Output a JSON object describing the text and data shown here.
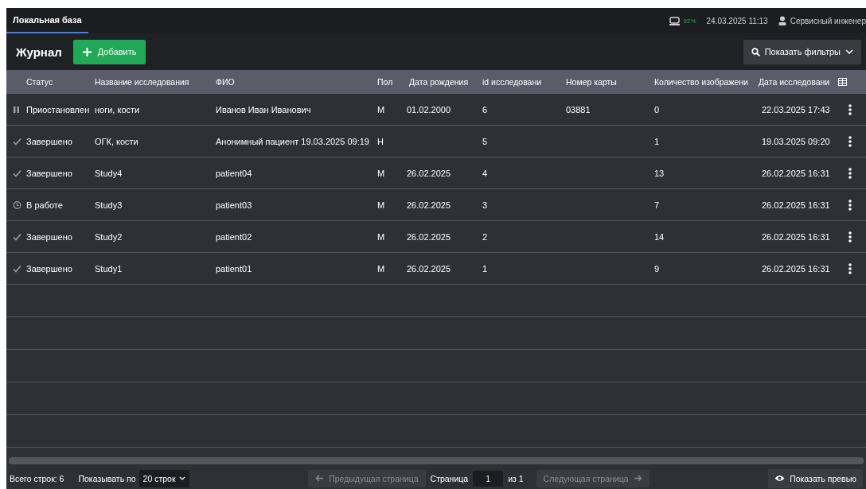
{
  "top_bar": {
    "tabs": [
      {
        "label": "Локальная база",
        "selected": true
      }
    ],
    "storage": "92%",
    "datetime": "24.03.2025 11:13",
    "user": "Сервисный инженер"
  },
  "toolbar": {
    "title": "Журнал",
    "add_button": "Добавить",
    "filters_button": "Показать фильтры"
  },
  "table": {
    "columns": [
      "Статус",
      "Название исследования",
      "ФИО",
      "Пол",
      "Дата рождения",
      "id исследовани",
      "Номер карты",
      "Количество изображени",
      "Дата исследовани"
    ],
    "rows": [
      {
        "kind": "paused",
        "status": "Приостановлен",
        "name": "ноги, кости",
        "patient": "Иванов Иван Иванович",
        "sex": "М",
        "birth_date": "01.02.2000",
        "study_id": "6",
        "card": "03881",
        "images": "0",
        "study_date": "22.03.2025 17:43"
      },
      {
        "kind": "done",
        "status": "Завершено",
        "name": "ОГК, кости",
        "patient": "Анонимный пациент 19.03.2025 09:19",
        "sex": "Н",
        "study_id": "5",
        "images": "1",
        "study_date": "19.03.2025 09:20"
      },
      {
        "kind": "done",
        "status": "Завершено",
        "name": "Study4",
        "patient": "patient04",
        "sex": "М",
        "birth_date": "26.02.2025",
        "study_id": "4",
        "images": "13",
        "study_date": "26.02.2025 16:31"
      },
      {
        "kind": "in_progress",
        "status": "В работе",
        "name": "Study3",
        "patient": "patient03",
        "sex": "М",
        "birth_date": "26.02.2025",
        "study_id": "3",
        "images": "7",
        "study_date": "26.02.2025 16:31"
      },
      {
        "kind": "done",
        "status": "Завершено",
        "name": "Study2",
        "patient": "patient02",
        "sex": "М",
        "birth_date": "26.02.2025",
        "study_id": "2",
        "images": "14",
        "study_date": "26.02.2025 16:31"
      },
      {
        "kind": "done",
        "status": "Завершено",
        "name": "Study1",
        "patient": "patient01",
        "sex": "М",
        "birth_date": "26.02.2025",
        "study_id": "1",
        "images": "9",
        "study_date": "26.02.2025 16:31"
      }
    ]
  },
  "footer": {
    "total": "Всего строк: 6",
    "page_size_label": "Показывать по",
    "page_size": "20 строк",
    "prev_button": {
      "label": "Предыдущая страница",
      "disabled": true
    },
    "page_label": "Страница",
    "page": "1",
    "page_count": "из 1",
    "next_button": {
      "label": "Следующая страница",
      "disabled": true
    },
    "preview_button": "Показать превью"
  }
}
